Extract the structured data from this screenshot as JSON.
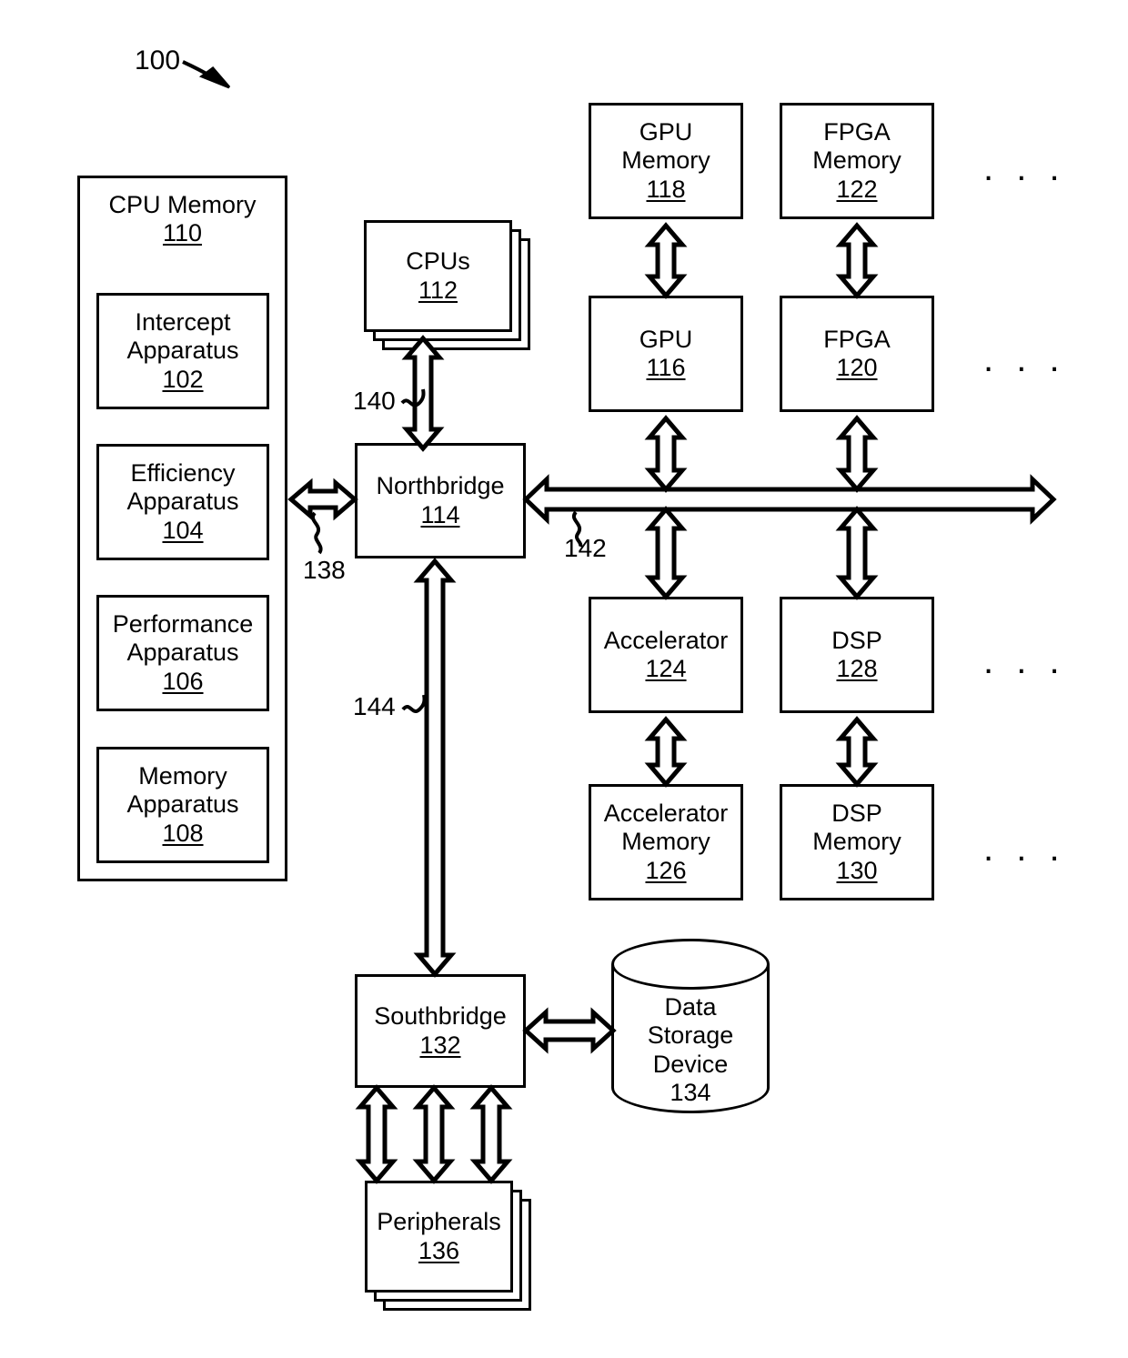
{
  "figure": {
    "number": "100",
    "ellipsis": ". . ."
  },
  "blocks": {
    "cpu_memory": {
      "title": "CPU Memory",
      "ref": "110"
    },
    "intercept_apparatus": {
      "line1": "Intercept",
      "line2": "Apparatus",
      "ref": "102"
    },
    "efficiency_apparatus": {
      "line1": "Efficiency",
      "line2": "Apparatus",
      "ref": "104"
    },
    "performance_apparatus": {
      "line1": "Performance",
      "line2": "Apparatus",
      "ref": "106"
    },
    "memory_apparatus": {
      "line1": "Memory",
      "line2": "Apparatus",
      "ref": "108"
    },
    "cpus": {
      "title": "CPUs",
      "ref": "112"
    },
    "northbridge": {
      "title": "Northbridge",
      "ref": "114"
    },
    "gpu_memory": {
      "line1": "GPU",
      "line2": "Memory",
      "ref": "118"
    },
    "gpu": {
      "title": "GPU",
      "ref": "116"
    },
    "fpga_memory": {
      "line1": "FPGA",
      "line2": "Memory",
      "ref": "122"
    },
    "fpga": {
      "title": "FPGA",
      "ref": "120"
    },
    "accelerator": {
      "title": "Accelerator",
      "ref": "124"
    },
    "accelerator_memory": {
      "line1": "Accelerator",
      "line2": "Memory",
      "ref": "126"
    },
    "dsp": {
      "title": "DSP",
      "ref": "128"
    },
    "dsp_memory": {
      "line1": "DSP",
      "line2": "Memory",
      "ref": "130"
    },
    "southbridge": {
      "title": "Southbridge",
      "ref": "132"
    },
    "data_storage_device": {
      "line1": "Data",
      "line2": "Storage",
      "line3": "Device",
      "ref": "134"
    },
    "peripherals": {
      "title": "Peripherals",
      "ref": "136"
    }
  },
  "leaders": {
    "cpu_memory_bus": "138",
    "cpu_bus": "140",
    "peripheral_bus": "142",
    "southbridge_bus": "144"
  }
}
